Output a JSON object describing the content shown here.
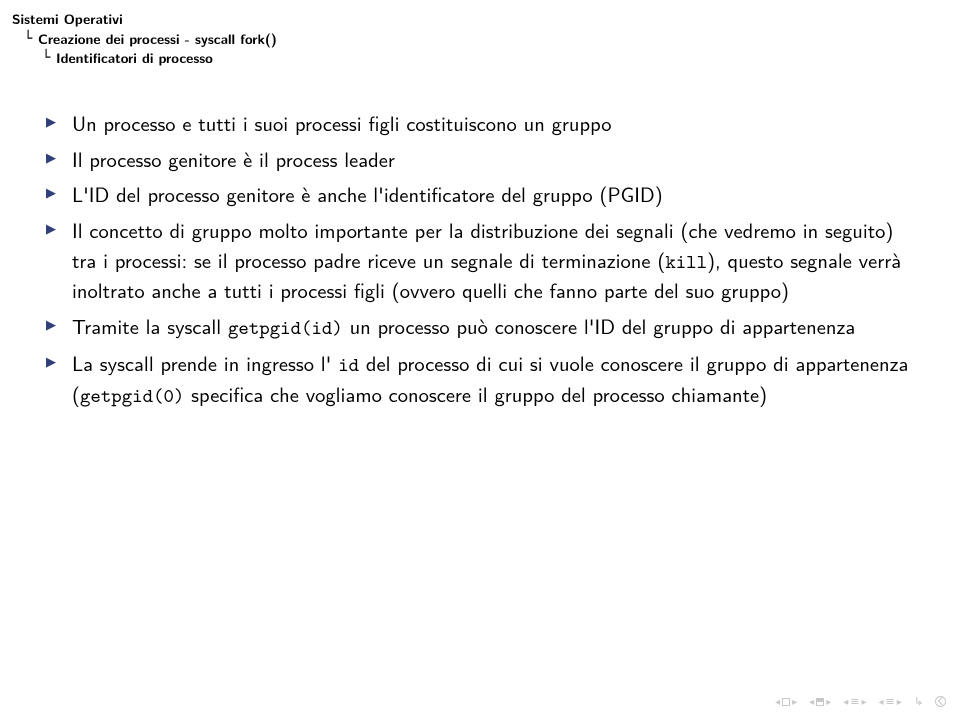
{
  "header": {
    "line1": "Sistemi Operativi",
    "line2": "Creazione dei processi - syscall fork()",
    "line3": "Identificatori di processo"
  },
  "bullets": [
    "Un processo e tutti i suoi processi figli costituiscono un gruppo",
    "Il processo genitore è il process leader",
    "L'ID del processo genitore è anche l'identificatore del gruppo (PGID)",
    "Il concetto di gruppo molto importante per la distribuzione dei segnali (che vedremo in seguito) tra i processi: se il processo padre riceve un segnale di terminazione (<tt>kill</tt>), questo segnale verrà inoltrato anche a tutti i processi figli (ovvero quelli che fanno parte del suo gruppo)",
    "Tramite la syscall <tt>getpgid(id)</tt> un processo può conoscere l'ID del gruppo di appartenenza",
    "La syscall prende in ingresso l' <tt>id</tt> del processo di cui si vuole conoscere il gruppo di appartenenza (<tt>getpgid(0)</tt> specifica che vogliamo conoscere il gruppo del processo chiamante)"
  ]
}
